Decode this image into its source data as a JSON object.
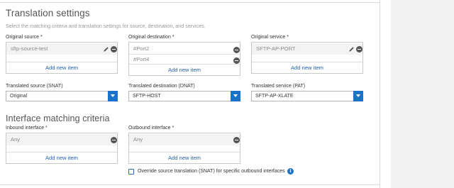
{
  "translation": {
    "title": "Translation settings",
    "description": "Select the matching criteria and translation settings for source, destination, and services.",
    "original_source": {
      "label": "Original source *",
      "items": [
        "sftp-source-test"
      ],
      "add_label": "Add new item"
    },
    "original_destination": {
      "label": "Original destination *",
      "items": [
        "#Port2",
        "#Port4"
      ],
      "add_label": "Add new item"
    },
    "original_service": {
      "label": "Original service *",
      "items": [
        "SFTP-AP-PORT"
      ],
      "add_label": "Add new item"
    },
    "translated_source": {
      "label": "Translated source (SNAT)",
      "value": "Original"
    },
    "translated_destination": {
      "label": "Translated destination (DNAT)",
      "value": "SFTP-HOST"
    },
    "translated_service": {
      "label": "Translated service (PAT)",
      "value": "SFTP-AP-XLATE"
    }
  },
  "interface": {
    "title": "Interface matching criteria",
    "inbound": {
      "label": "Inbound interface *",
      "items": [
        "Any"
      ],
      "add_label": "Add new item"
    },
    "outbound": {
      "label": "Outbound interface *",
      "items": [
        "Any"
      ],
      "add_label": "Add new item"
    },
    "override_label": "Override source translation (SNAT) for specific outbound interfaces"
  },
  "colors": {
    "accent": "#1a73c8",
    "link": "#2563b0",
    "panel": "#f2f2f2"
  }
}
